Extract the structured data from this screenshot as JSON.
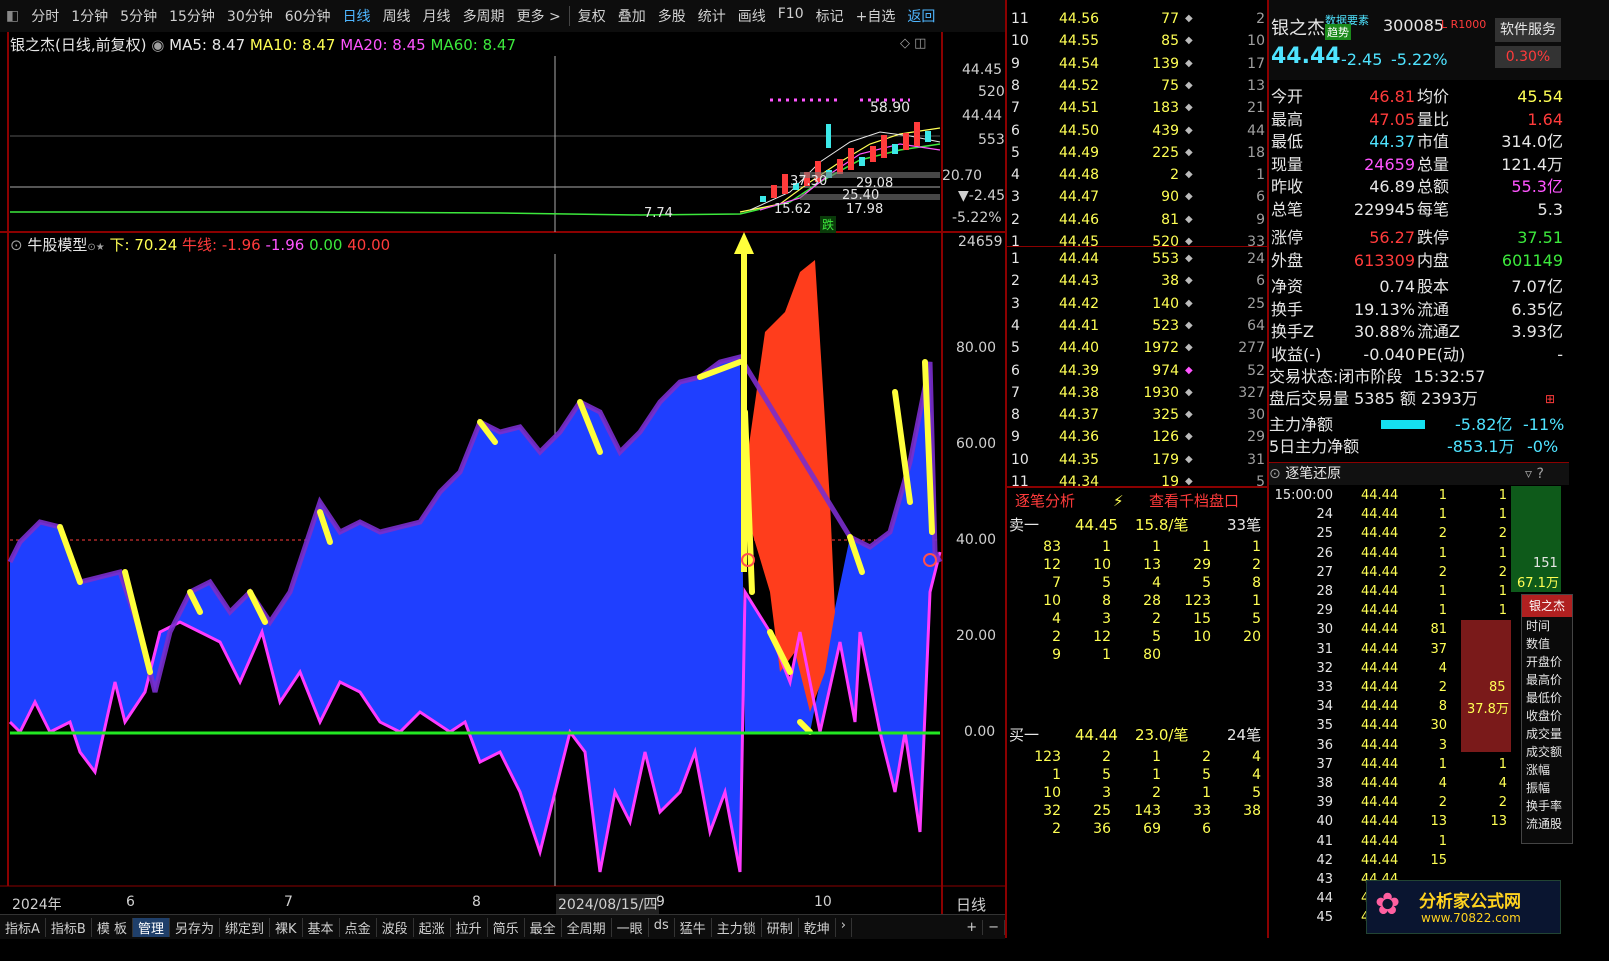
{
  "toolbar": {
    "items": [
      "分时",
      "1分钟",
      "5分钟",
      "15分钟",
      "30分钟",
      "60分钟",
      "日线",
      "周线",
      "月线",
      "多周期",
      "更多 >"
    ],
    "tools": [
      "复权",
      "叠加",
      "多股",
      "统计",
      "画线",
      "F10",
      "标记",
      "+自选",
      "返回"
    ]
  },
  "price_panel": {
    "title": "银之杰(日线,前复权)",
    "ma5": "MA5: 8.47",
    "ma10": "MA10: 8.47",
    "ma20": "MA20: 8.45",
    "ma60": "MA60: 8.47",
    "axis": [
      "44.45",
      "520",
      "44.44",
      "553",
      "20.70",
      "-2.45",
      "-5.22%"
    ],
    "labels": [
      "58.90",
      "37.30",
      "29.08",
      "25.40",
      "15.62",
      "17.98",
      "7.74"
    ],
    "die": "跌",
    "colors": {
      "ma5": "#e6e6e6",
      "ma10": "#ffff54",
      "ma20": "#ff55ff",
      "ma60": "#3ce83c"
    }
  },
  "indicator_panel": {
    "title": "牛股模型",
    "xia": "下: 70.24",
    "niuxian": "牛线: -1.96",
    "v2": "-1.96",
    "v3": "0.00",
    "v4": "40.00",
    "top_value": "24659",
    "axis": [
      "80.00",
      "60.00",
      "40.00",
      "20.00",
      "0.00"
    ]
  },
  "xaxis": {
    "labels": [
      "2024年",
      "6",
      "7",
      "8",
      "2024/08/15/四",
      "9",
      "10"
    ],
    "period": "日线"
  },
  "bottombar": {
    "items": [
      "指标A",
      "指标B",
      "模 板",
      "管理",
      "另存为",
      "绑定到",
      "裸K",
      "基本",
      "点金",
      "波段",
      "起涨",
      "拉升",
      "简乐",
      "最全",
      "全周期",
      "一眼",
      "ds",
      "猛牛",
      "主力锁",
      "研制",
      "乾坤",
      "›"
    ],
    "active": "管理",
    "plus": "+",
    "minus": "−"
  },
  "orderbook": {
    "asks": [
      {
        "n": "11",
        "p": "44.56",
        "v": "77",
        "c": "2"
      },
      {
        "n": "10",
        "p": "44.55",
        "v": "85",
        "c": "10"
      },
      {
        "n": "9",
        "p": "44.54",
        "v": "139",
        "c": "17"
      },
      {
        "n": "8",
        "p": "44.52",
        "v": "75",
        "c": "13"
      },
      {
        "n": "7",
        "p": "44.51",
        "v": "183",
        "c": "21"
      },
      {
        "n": "6",
        "p": "44.50",
        "v": "439",
        "c": "44"
      },
      {
        "n": "5",
        "p": "44.49",
        "v": "225",
        "c": "18"
      },
      {
        "n": "4",
        "p": "44.48",
        "v": "2",
        "c": "1"
      },
      {
        "n": "3",
        "p": "44.47",
        "v": "90",
        "c": "6"
      },
      {
        "n": "2",
        "p": "44.46",
        "v": "81",
        "c": "9"
      },
      {
        "n": "1",
        "p": "44.45",
        "v": "520",
        "c": "33"
      }
    ],
    "bids": [
      {
        "n": "1",
        "p": "44.44",
        "v": "553",
        "c": "24"
      },
      {
        "n": "2",
        "p": "44.43",
        "v": "38",
        "c": "6"
      },
      {
        "n": "3",
        "p": "44.42",
        "v": "140",
        "c": "25"
      },
      {
        "n": "4",
        "p": "44.41",
        "v": "523",
        "c": "64"
      },
      {
        "n": "5",
        "p": "44.40",
        "v": "1972",
        "c": "277"
      },
      {
        "n": "6",
        "p": "44.39",
        "v": "974",
        "c": "52"
      },
      {
        "n": "7",
        "p": "44.38",
        "v": "1930",
        "c": "327"
      },
      {
        "n": "8",
        "p": "44.37",
        "v": "325",
        "c": "30"
      },
      {
        "n": "9",
        "p": "44.36",
        "v": "126",
        "c": "29"
      },
      {
        "n": "10",
        "p": "44.35",
        "v": "179",
        "c": "31"
      },
      {
        "n": "11",
        "p": "44.34",
        "v": "19",
        "c": "5"
      }
    ],
    "tab_a": "逐笔分析",
    "tab_b": "查看千档盘口",
    "sell1": {
      "label": "卖一",
      "price": "44.45",
      "avg": "15.8/笔",
      "cnt": "33笔"
    },
    "sell_grid": [
      [
        "83",
        "1",
        "1",
        "1",
        "1"
      ],
      [
        "12",
        "10",
        "13",
        "29",
        "2"
      ],
      [
        "7",
        "5",
        "4",
        "5",
        "8"
      ],
      [
        "10",
        "8",
        "28",
        "123",
        "1"
      ],
      [
        "4",
        "3",
        "2",
        "15",
        "5"
      ],
      [
        "2",
        "12",
        "5",
        "10",
        "20"
      ],
      [
        "9",
        "1",
        "80",
        "",
        ""
      ]
    ],
    "buy1": {
      "label": "买一",
      "price": "44.44",
      "avg": "23.0/笔",
      "cnt": "24笔"
    },
    "buy_grid": [
      [
        "123",
        "2",
        "1",
        "2",
        "4"
      ],
      [
        "1",
        "5",
        "1",
        "5",
        "4"
      ],
      [
        "10",
        "3",
        "2",
        "1",
        "5"
      ],
      [
        "32",
        "25",
        "143",
        "33",
        "38"
      ],
      [
        "2",
        "36",
        "69",
        "6",
        ""
      ]
    ]
  },
  "quote": {
    "name": "银之杰",
    "tag1": "数据要素",
    "tag2": "趋势",
    "code": "300085",
    "lv": "L R1000",
    "service": "软件服务",
    "service_pct": "0.30%",
    "price": "44.44",
    "change": "-2.45",
    "pct": "-5.22%",
    "rows": [
      [
        "今开",
        "46.81",
        "均价",
        "45.54"
      ],
      [
        "最高",
        "47.05",
        "量比",
        "1.64"
      ],
      [
        "最低",
        "44.37",
        "市值",
        "314.0亿"
      ],
      [
        "现量",
        "24659",
        "总量",
        "121.4万"
      ],
      [
        "昨收",
        "46.89",
        "总额",
        "55.3亿"
      ],
      [
        "总笔",
        "229945",
        "每笔",
        "5.3"
      ],
      [
        "涨停",
        "56.27",
        "跌停",
        "37.51"
      ],
      [
        "外盘",
        "613309",
        "内盘",
        "601149"
      ],
      [
        "净资",
        "0.74",
        "股本",
        "7.07亿"
      ],
      [
        "换手",
        "19.13%",
        "流通",
        "6.35亿"
      ],
      [
        "换手Z",
        "30.88%",
        "流通Z",
        "3.93亿"
      ],
      [
        "收益(-)",
        "-0.040",
        "PE(动)",
        "-"
      ]
    ],
    "status_label": "交易状态:",
    "status": "闭市阶段",
    "status_time": "15:32:57",
    "after_label": "盘后交易量",
    "after_vol": "5385",
    "after_amt_label": "额",
    "after_amt": "2393万",
    "main_net_label": "主力净额",
    "main_net": "-5.82亿",
    "main_net_pct": "-11%",
    "main5_label": "5日主力净额",
    "main5": "-853.1万",
    "main5_pct": "-0%"
  },
  "tape": {
    "title": "逐笔还原",
    "rows": [
      [
        "15:00:00",
        "44.44",
        "1",
        "1"
      ],
      [
        "24",
        "44.44",
        "1",
        "1"
      ],
      [
        "25",
        "44.44",
        "2",
        "2"
      ],
      [
        "26",
        "44.44",
        "1",
        "1"
      ],
      [
        "27",
        "44.44",
        "2",
        "2"
      ],
      [
        "28",
        "44.44",
        "1",
        "1"
      ],
      [
        "29",
        "44.44",
        "1",
        "1"
      ],
      [
        "30",
        "44.44",
        "81",
        "81"
      ],
      [
        "31",
        "44.44",
        "37",
        ""
      ],
      [
        "32",
        "44.44",
        "4",
        ""
      ],
      [
        "33",
        "44.44",
        "2",
        ""
      ],
      [
        "34",
        "44.44",
        "8",
        ""
      ],
      [
        "35",
        "44.44",
        "30",
        ""
      ],
      [
        "36",
        "44.44",
        "3",
        ""
      ],
      [
        "37",
        "44.44",
        "1",
        "1"
      ],
      [
        "38",
        "44.44",
        "4",
        "4"
      ],
      [
        "39",
        "44.44",
        "2",
        "2"
      ],
      [
        "40",
        "44.44",
        "13",
        "13"
      ],
      [
        "41",
        "44.44",
        "1",
        ""
      ],
      [
        "42",
        "44.44",
        "15",
        ""
      ],
      [
        "43",
        "44.44",
        "",
        ""
      ],
      [
        "44",
        "44.44",
        "",
        ""
      ],
      [
        "45",
        "44.44",
        "",
        ""
      ]
    ],
    "side_green": "151",
    "side_green2": "67.1万",
    "side_red": "85",
    "side_red2": "37.8万",
    "popup_title": "银之杰",
    "popup_items": [
      "时间",
      "数值",
      "开盘价",
      "最高价",
      "最低价",
      "收盘价",
      "成交量",
      "成交额",
      "涨幅",
      "振幅",
      "换手率",
      "流通股"
    ]
  },
  "watermark": {
    "logo": "分析家公式网",
    "url": "www.70822.com"
  }
}
